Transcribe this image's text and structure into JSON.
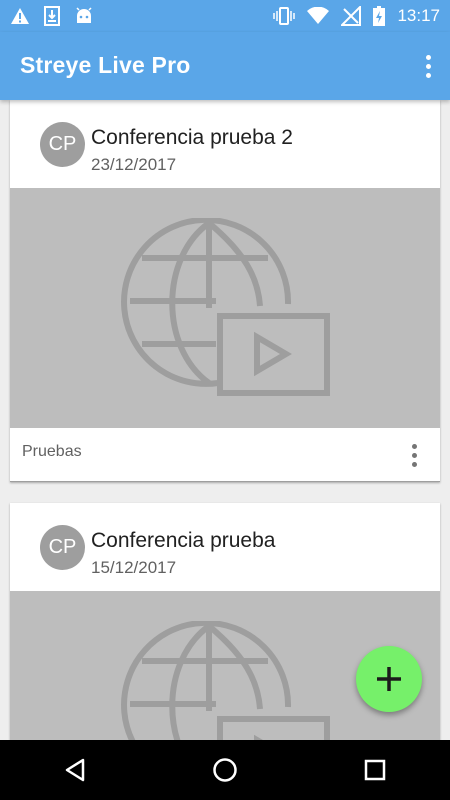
{
  "status_bar": {
    "time": "13:17",
    "icons": [
      "warning-icon",
      "download-icon",
      "android-icon",
      "vibrate-icon",
      "wifi-icon",
      "no-signal-icon",
      "battery-charging-icon"
    ]
  },
  "app_bar": {
    "title": "Streye Live Pro",
    "overflow_icon": "more-vert-icon"
  },
  "cards": [
    {
      "avatar": "CP",
      "title": "Conferencia prueba 2",
      "date": "23/12/2017",
      "media_icon": "globe-video-icon",
      "footer_label": "Pruebas",
      "menu_icon": "more-vert-icon"
    },
    {
      "avatar": "CP",
      "title": "Conferencia prueba",
      "date": "15/12/2017",
      "media_icon": "globe-video-icon"
    }
  ],
  "fab": {
    "icon": "plus-icon",
    "color": "#76f06a"
  },
  "nav": {
    "buttons": [
      "back-icon",
      "home-icon",
      "recents-icon"
    ]
  },
  "colors": {
    "primary": "#5aa6e8",
    "media_placeholder": "#bdbdbd",
    "avatar": "#9e9e9e"
  }
}
